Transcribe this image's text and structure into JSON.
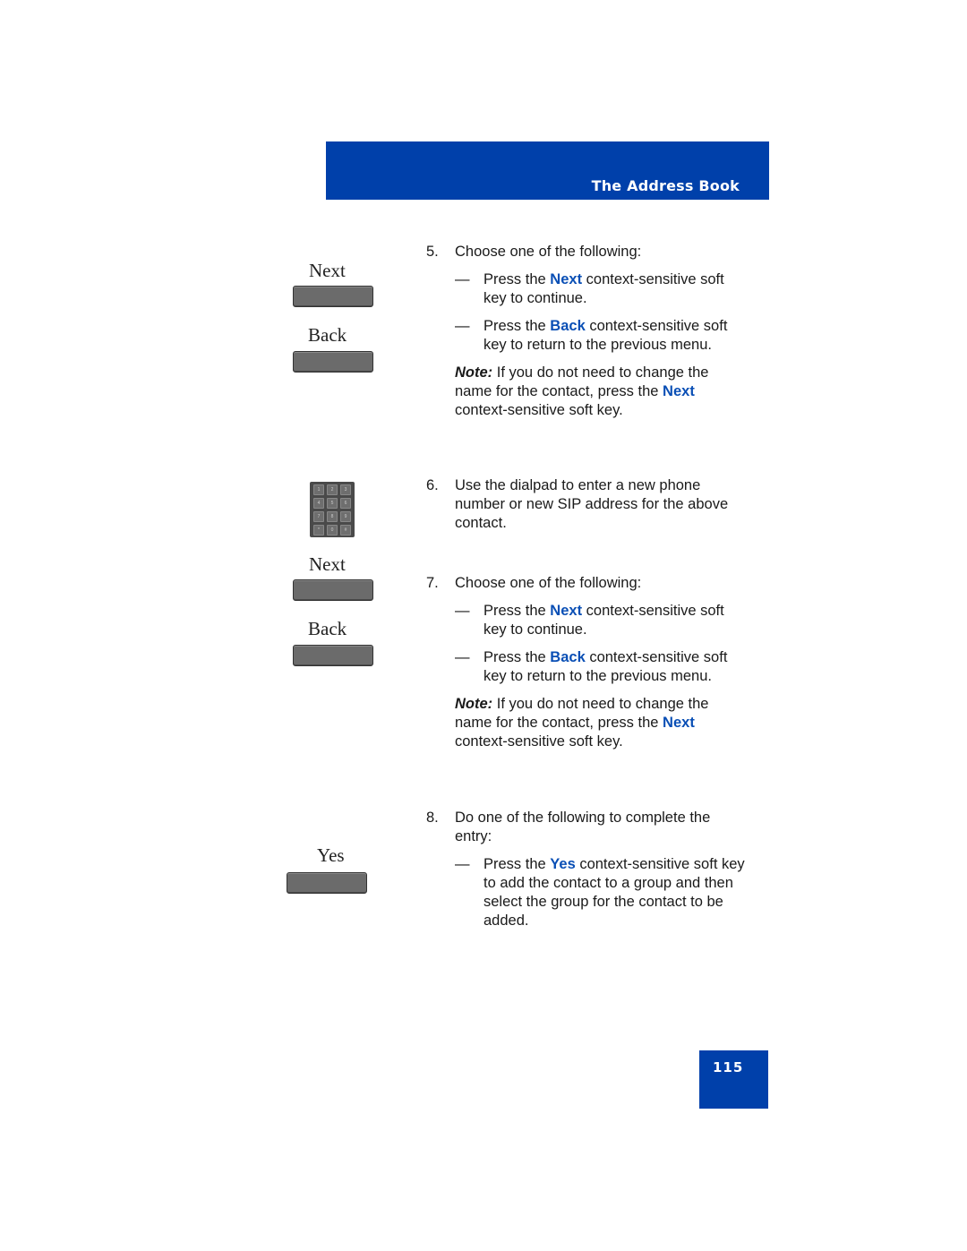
{
  "header": {
    "title": "The Address Book"
  },
  "softkeys": {
    "next_label": "Next",
    "back_label": "Back",
    "yes_label": "Yes"
  },
  "dialpad": {
    "keys": [
      "1",
      "2",
      "3",
      "4",
      "5",
      "6",
      "7",
      "8",
      "9",
      "*",
      "0",
      "#"
    ]
  },
  "steps": {
    "s5": {
      "num": "5.",
      "text": "Choose one of the following:",
      "b1": {
        "dash": "—",
        "pre": "Press the ",
        "kw": "Next",
        "post": " context-sensitive soft key to continue."
      },
      "b2": {
        "dash": "—",
        "pre": "Press the ",
        "kw": "Back",
        "post": " context-sensitive soft key to return to the previous menu."
      },
      "note": {
        "label": "Note:",
        "pre": " If you do not need to change the name for the contact, press the ",
        "kw": "Next",
        "post": " context-sensitive soft key."
      }
    },
    "s6": {
      "num": "6.",
      "text": "Use the dialpad to enter a new phone number or new SIP address for the above contact."
    },
    "s7": {
      "num": "7.",
      "text": "Choose one of the following:",
      "b1": {
        "dash": "—",
        "pre": "Press the ",
        "kw": "Next",
        "post": " context-sensitive soft key to continue."
      },
      "b2": {
        "dash": "—",
        "pre": "Press the ",
        "kw": "Back",
        "post": " context-sensitive soft key to return to the previous menu."
      },
      "note": {
        "label": "Note:",
        "pre": " If you do not need to change the name for the contact, press the ",
        "kw": "Next",
        "post": " context-sensitive soft key."
      }
    },
    "s8": {
      "num": "8.",
      "text": "Do one of the following to complete the entry:",
      "b1": {
        "dash": "—",
        "pre": "Press the ",
        "kw": "Yes",
        "post": " context-sensitive soft key to add the contact to a group and then select the group for the contact to be added."
      }
    }
  },
  "footer": {
    "page_number": "115"
  },
  "colors": {
    "brand_blue": "#0040aa",
    "keyword_blue": "#0a4fb5"
  }
}
